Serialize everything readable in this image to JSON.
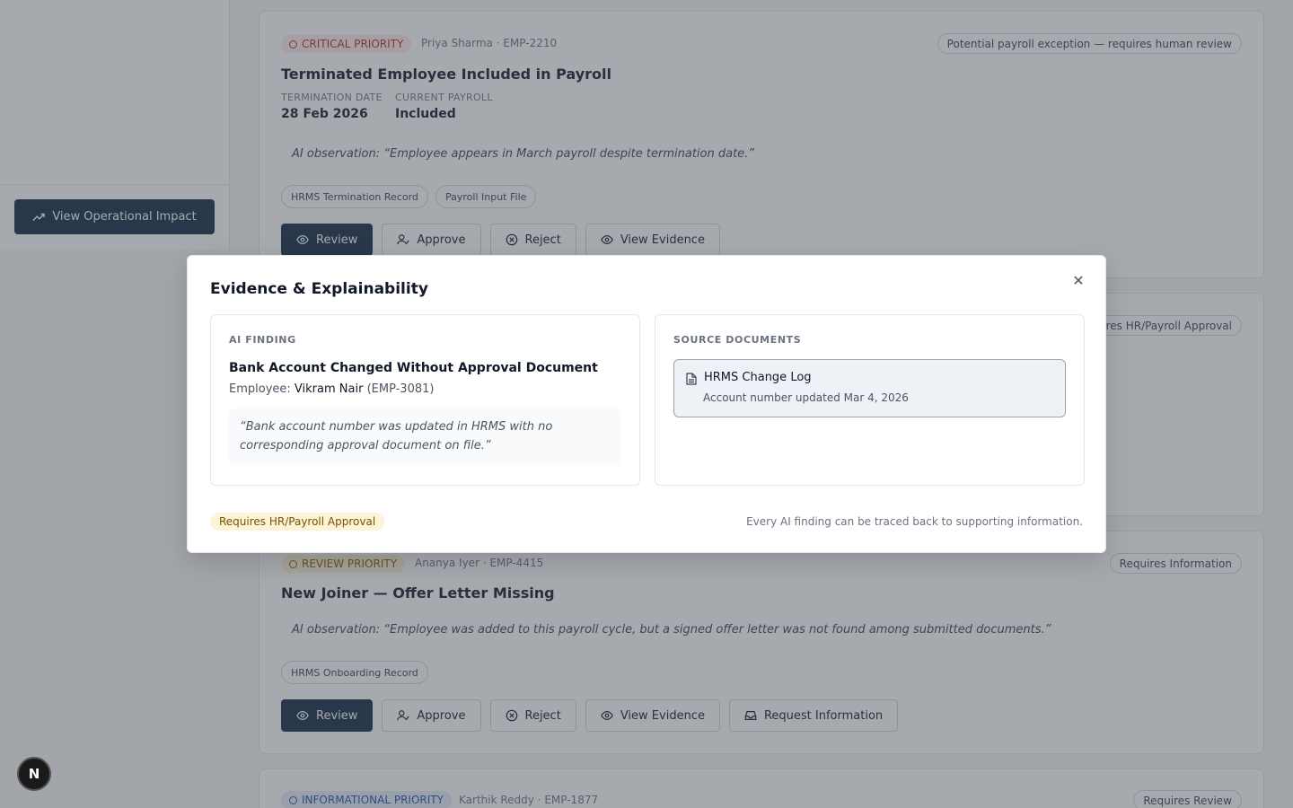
{
  "sidebar": {
    "impact_button": "View Operational Impact"
  },
  "cards": [
    {
      "priority": "CRITICAL PRIORITY",
      "employee": "Priya Sharma · EMP-2210",
      "status": "Potential payroll exception — requires human review",
      "title": "Terminated Employee Included in Payroll",
      "meta": [
        {
          "label": "TERMINATION DATE",
          "value": "28 Feb 2026"
        },
        {
          "label": "CURRENT PAYROLL",
          "value": "Included"
        }
      ],
      "observation": "AI observation: “Employee appears in March payroll despite termination date.”",
      "chips": [
        "HRMS Termination Record",
        "Payroll Input File"
      ]
    },
    {
      "status": "Requires HR/Payroll Approval"
    },
    {
      "priority": "REVIEW PRIORITY",
      "employee": "Ananya Iyer · EMP-4415",
      "status": "Requires Information",
      "title": "New Joiner — Offer Letter Missing",
      "observation": "AI observation: “Employee was added to this payroll cycle, but a signed offer letter was not found among submitted documents.”",
      "chips": [
        "HRMS Onboarding Record"
      ]
    },
    {
      "priority": "INFORMATIONAL PRIORITY",
      "employee": "Karthik Reddy · EMP-1877",
      "status": "Requires Review"
    }
  ],
  "actions": {
    "review": "Review",
    "approve": "Approve",
    "reject": "Reject",
    "view_evidence": "View Evidence",
    "request_info": "Request Information"
  },
  "modal": {
    "title": "Evidence & Explainability",
    "finding_label": "AI FINDING",
    "finding_title": "Bank Account Changed Without Approval Document",
    "employee_prefix": "Employee:",
    "employee_name": "Vikram Nair",
    "employee_id": "(EMP-3081)",
    "quote": "“Bank account number was updated in HRMS with no corresponding approval document on file.”",
    "sources_label": "SOURCE DOCUMENTS",
    "documents": [
      {
        "name": "HRMS Change Log",
        "description": "Account number updated Mar 4, 2026"
      }
    ],
    "approval_badge": "Requires HR/Payroll Approval",
    "footnote": "Every AI finding can be traced back to supporting information."
  },
  "fab_label": "N",
  "colors": {
    "brand": "#0f2540",
    "critical": "#b4232a",
    "review": "#8a5a00",
    "info": "#1f4fa8"
  }
}
